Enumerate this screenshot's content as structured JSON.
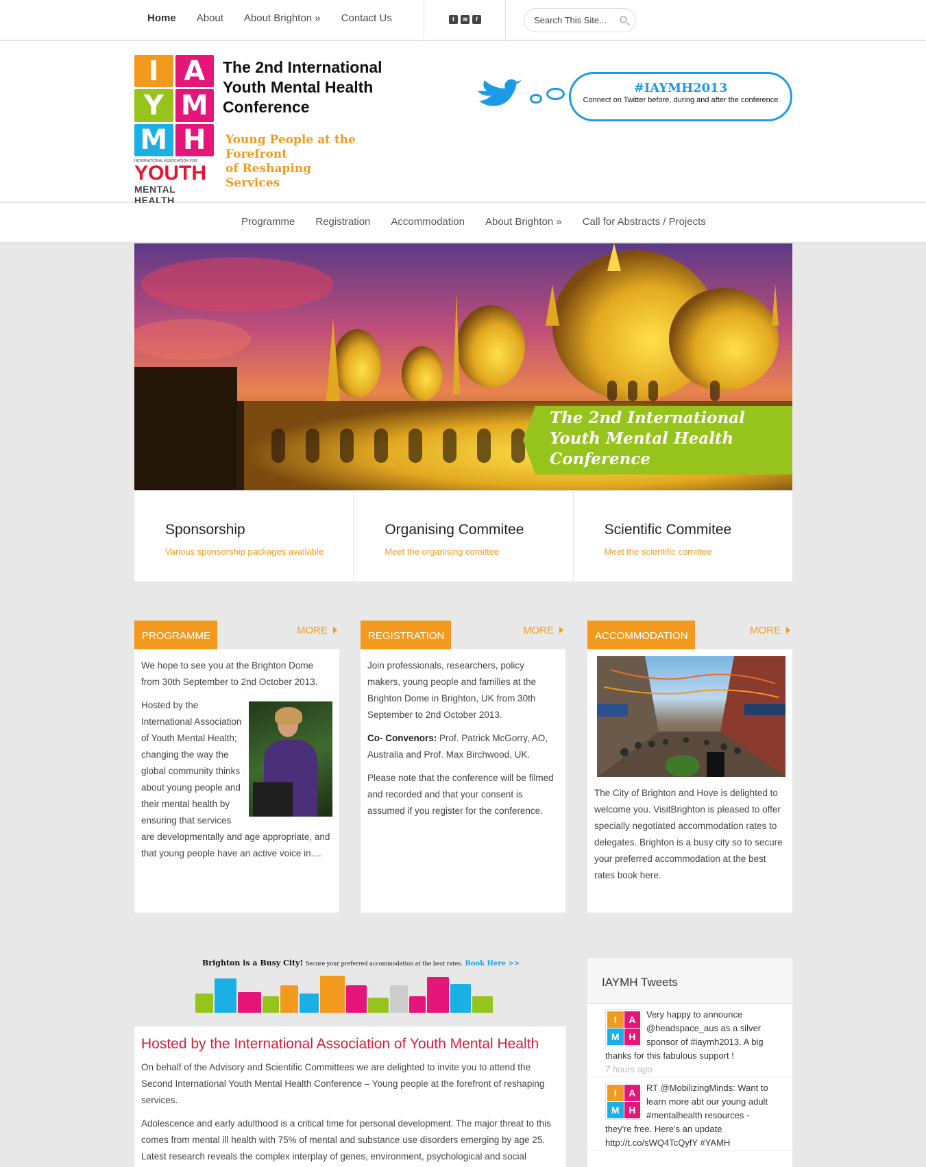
{
  "topbar": {
    "nav": [
      "Home",
      "About",
      "About Brighton »",
      "Contact Us"
    ],
    "social_icons": [
      "twitter-icon",
      "rss-icon",
      "facebook-icon"
    ],
    "search_placeholder": "Search This Site..."
  },
  "header": {
    "logo": {
      "letters": [
        "I",
        "A",
        "Y",
        "M",
        "M",
        "H"
      ],
      "colors": [
        "#f39a1e",
        "#e5157a",
        "#96c41d",
        "#1ab0e5"
      ],
      "assoc_text": "INTERNATIONAL ASSOCIATION FOR",
      "youth": "YOUTH",
      "mental_health": "MENTAL HEALTH"
    },
    "title": "The 2nd International Youth Mental Health Conference",
    "tagline": [
      "Young People at the",
      "Forefront",
      "of Reshaping",
      "Services"
    ],
    "twitter": {
      "hashtag": "#IAYMH2013",
      "text": "Connect on Twitter before, during and after the conference"
    }
  },
  "mainnav": [
    "Programme",
    "Registration",
    "Accommodation",
    "About Brighton »",
    "Call for Abstracts / Projects"
  ],
  "hero": {
    "caption": [
      "The 2nd International",
      "Youth Mental Health",
      "Conference"
    ]
  },
  "features": [
    {
      "title": "Sponsorship",
      "link": "Various sponsorship packages available"
    },
    {
      "title": "Organising Commitee",
      "link": "Meet the organising comittee"
    },
    {
      "title": "Scientific Commitee",
      "link": "Meet the scientific comittee"
    }
  ],
  "columns": {
    "more_label": "MORE",
    "programme": {
      "tab": "PROGRAMME",
      "p1": "We hope to see you at the Brighton Dome from 30th September to 2nd October 2013.",
      "p2": "Hosted by the International Association of Youth Mental Health; changing the way the global community thinks about young people and their mental health by ensuring that services are developmentally and age appropriate, and that young people have an active voice in...."
    },
    "registration": {
      "tab": "REGISTRATION",
      "p1": "Join professionals, researchers, policy makers, young people and families at the Brighton Dome in Brighton, UK from 30th September to 2nd October 2013.",
      "convenors_label": "Co- Convenors:",
      "convenors": " Prof. Patrick McGorry, AO, Australia and Prof. Max Birchwood, UK.",
      "p3": "Please note that the conference will be filmed and recorded and that your consent is assumed if you register for the conference."
    },
    "accommodation": {
      "tab": "ACCOMMODATION",
      "p1": "The City of Brighton and Hove is delighted to welcome you. VisitBrighton is pleased to offer specially negotiated accommodation rates to delegates. Brighton is a busy city so to secure your preferred accommodation at the best rates book here."
    }
  },
  "banner": {
    "headline": "Brighton is a Busy City!",
    "text": "Secure your preferred accommodation at the best rates.",
    "link": "Book Here >>"
  },
  "hosted": {
    "title": "Hosted by the International Association of Youth Mental Health",
    "p1": "On behalf of the Advisory and Scientific Committees we are delighted to invite you to attend the Second International Youth Mental Health Conference – Young people at the forefront of reshaping services.",
    "p2": "Adolescence and early adulthood is a critical time for personal development. The major threat to this comes from mental ill health with 75% of mental and substance use disorders emerging by age 25. Latest research reveals the complex interplay of genes, environment, psychological and social"
  },
  "tweets": {
    "title": "IAYMH Tweets",
    "items": [
      {
        "text": "Very happy to announce @headspace_aus as a silver sponsor of #iaymh2013. A big thanks for this fabulous support !",
        "time": "7 hours ago"
      },
      {
        "text": "RT @MobilizingMinds: Want to learn more abt our young adult #mentalhealth resources - they're free. Here's an update http://t.co/sWQ4TcQyfY #YAMH",
        "time": ""
      }
    ]
  }
}
